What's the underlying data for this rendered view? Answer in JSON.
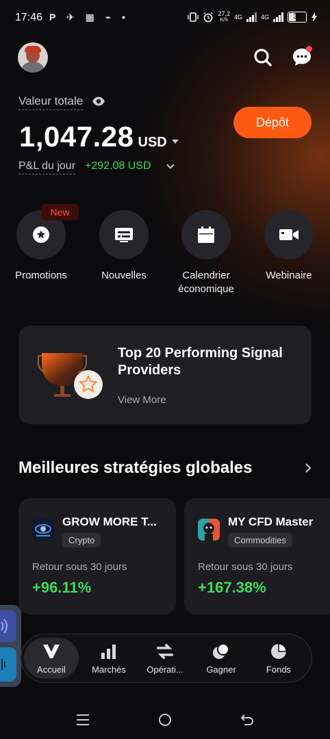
{
  "status_bar": {
    "time": "17:46",
    "left_icons": "P ✈ ▦ ⌁ •",
    "net_speed_value": "27,2",
    "net_speed_unit": "K/S",
    "network_a": "4G",
    "network_b": "4G",
    "battery": "38"
  },
  "header": {
    "avatar": "avatar",
    "search_icon": "search-icon",
    "chat_icon": "chat-icon",
    "has_notification": true
  },
  "balance": {
    "label": "Valeur totale",
    "value": "1,047.28",
    "currency": "USD",
    "pnl_label": "P&L du jour",
    "pnl_value": "+292.08 USD"
  },
  "deposit_button": "Dépôt",
  "quick_actions": [
    {
      "label": "Promotions",
      "icon": "star-icon",
      "badge": "New"
    },
    {
      "label": "Nouvelles",
      "icon": "news-icon"
    },
    {
      "label": "Calendrier\néconomique",
      "icon": "calendar-icon"
    },
    {
      "label": "Webinaire",
      "icon": "video-icon"
    }
  ],
  "promo": {
    "title": "Top 20 Performing Signal Providers",
    "link": "View More",
    "icon": "trophy-icon"
  },
  "strategies": {
    "title": "Meilleures stratégies globales",
    "items": [
      {
        "name": "GROW MORE T...",
        "tag": "Crypto",
        "return_label": "Retour sous 30 jours",
        "return_value": "+96.11%"
      },
      {
        "name": "MY CFD Master",
        "tag": "Commodities",
        "return_label": "Retour sous 30 jours",
        "return_value": "+167.38%"
      }
    ]
  },
  "bottom_nav": {
    "items": [
      {
        "label": "Accueil",
        "icon": "home-logo-icon",
        "active": true
      },
      {
        "label": "Marchés",
        "icon": "bar-chart-icon"
      },
      {
        "label": "Opérati...",
        "icon": "transfer-arrows-icon"
      },
      {
        "label": "Gagner",
        "icon": "coins-icon"
      },
      {
        "label": "Fonds",
        "icon": "pie-chart-icon"
      }
    ]
  },
  "colors": {
    "accent": "#ff5a12",
    "positive": "#3ddc5a",
    "card": "#1e1e23",
    "background": "#0b0b0d"
  }
}
